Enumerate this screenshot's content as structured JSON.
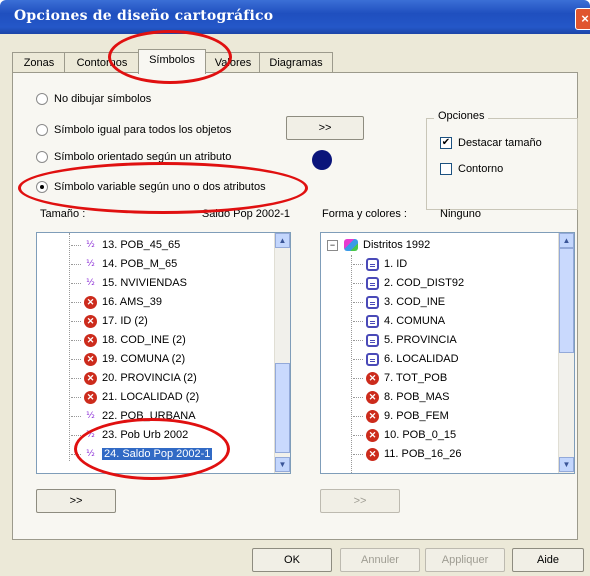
{
  "window": {
    "title": "Opciones de diseño cartográfico",
    "close_label": "×"
  },
  "tabs": [
    {
      "label": "Zonas"
    },
    {
      "label": "Contornos"
    },
    {
      "label": "Símbolos"
    },
    {
      "label": "Valores"
    },
    {
      "label": "Diagramas"
    }
  ],
  "radios": [
    {
      "label": "No dibujar símbolos",
      "checked": false
    },
    {
      "label": "Símbolo igual para todos los objetos",
      "checked": false
    },
    {
      "label": "Símbolo orientado según un atributo",
      "checked": false
    },
    {
      "label": "Símbolo variable según uno o dos atributos",
      "checked": true
    }
  ],
  "symbol_button_label": ">>",
  "symbol_color": "#0a147a",
  "opciones": {
    "title": "Opciones",
    "destacar_label": "Destacar tamaño",
    "destacar_checked": true,
    "contorno_label": "Contorno",
    "contorno_checked": false
  },
  "tamano": {
    "label": "Tamaño :",
    "value": "Saldo Pop 2002-1",
    "items": [
      {
        "label": "13. POB_45_65",
        "icon": "fraction-icon"
      },
      {
        "label": "14. POB_M_65",
        "icon": "fraction-icon"
      },
      {
        "label": "15. NVIVIENDAS",
        "icon": "fraction-icon"
      },
      {
        "label": "16. AMS_39",
        "icon": "x-icon"
      },
      {
        "label": "17. ID (2)",
        "icon": "x-icon"
      },
      {
        "label": "18. COD_INE (2)",
        "icon": "x-icon"
      },
      {
        "label": "19. COMUNA (2)",
        "icon": "x-icon"
      },
      {
        "label": "20. PROVINCIA (2)",
        "icon": "x-icon"
      },
      {
        "label": "21. LOCALIDAD (2)",
        "icon": "x-icon"
      },
      {
        "label": "22. POB_URBANA",
        "icon": "fraction-icon"
      },
      {
        "label": "23. Pob Urb 2002",
        "icon": "fraction-icon"
      },
      {
        "label": "24. Saldo Pop 2002-1",
        "icon": "fraction-icon",
        "selected": true
      }
    ],
    "button_label": ">>"
  },
  "forma": {
    "label": "Forma y colores :",
    "value": "Ninguno",
    "root_label": "Distritos 1992",
    "items": [
      {
        "label": "1. ID",
        "icon": "list-icon"
      },
      {
        "label": "2. COD_DIST92",
        "icon": "list-icon"
      },
      {
        "label": "3. COD_INE",
        "icon": "list-icon"
      },
      {
        "label": "4. COMUNA",
        "icon": "list-icon"
      },
      {
        "label": "5. PROVINCIA",
        "icon": "list-icon"
      },
      {
        "label": "6. LOCALIDAD",
        "icon": "list-icon"
      },
      {
        "label": "7. TOT_POB",
        "icon": "x-icon"
      },
      {
        "label": "8. POB_MAS",
        "icon": "x-icon"
      },
      {
        "label": "9. POB_FEM",
        "icon": "x-icon"
      },
      {
        "label": "10. POB_0_15",
        "icon": "x-icon"
      },
      {
        "label": "11. POB_16_26",
        "icon": "x-icon"
      }
    ],
    "button_label": ">>"
  },
  "footer": {
    "ok": "OK",
    "annuler": "Annuler",
    "appliquer": "Appliquer",
    "aide": "Aide"
  }
}
